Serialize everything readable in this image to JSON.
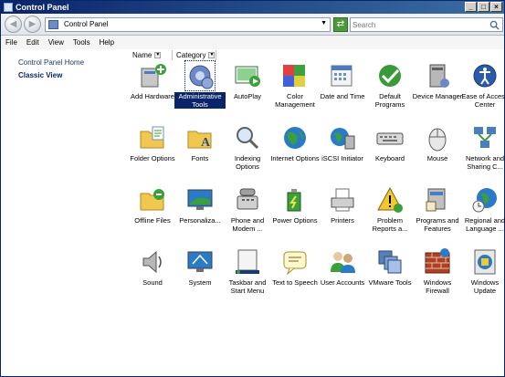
{
  "window": {
    "title": "Control Panel"
  },
  "title_buttons": [
    "_",
    "□",
    "×"
  ],
  "address": {
    "text": "Control Panel"
  },
  "search": {
    "placeholder": "Search"
  },
  "menu": [
    "File",
    "Edit",
    "View",
    "Tools",
    "Help"
  ],
  "left_pane": {
    "home": "Control Panel Home",
    "classic": "Classic View"
  },
  "columns": [
    "Name",
    "Category"
  ],
  "items": [
    {
      "label": "Add Hardware",
      "icon": "add-hardware-icon"
    },
    {
      "label": "Administrative Tools",
      "icon": "administrative-tools-icon",
      "selected": true
    },
    {
      "label": "AutoPlay",
      "icon": "autoplay-icon"
    },
    {
      "label": "Color Management",
      "icon": "color-management-icon"
    },
    {
      "label": "Date and Time",
      "icon": "date-time-icon"
    },
    {
      "label": "Default Programs",
      "icon": "default-programs-icon"
    },
    {
      "label": "Device Manager",
      "icon": "device-manager-icon"
    },
    {
      "label": "Ease of Access Center",
      "icon": "ease-of-access-icon"
    },
    {
      "label": "Folder Options",
      "icon": "folder-options-icon"
    },
    {
      "label": "Fonts",
      "icon": "fonts-icon"
    },
    {
      "label": "Indexing Options",
      "icon": "indexing-options-icon"
    },
    {
      "label": "Internet Options",
      "icon": "internet-options-icon"
    },
    {
      "label": "iSCSI Initiator",
      "icon": "iscsi-initiator-icon"
    },
    {
      "label": "Keyboard",
      "icon": "keyboard-icon"
    },
    {
      "label": "Mouse",
      "icon": "mouse-icon"
    },
    {
      "label": "Network and Sharing C...",
      "icon": "network-sharing-icon"
    },
    {
      "label": "Offline Files",
      "icon": "offline-files-icon"
    },
    {
      "label": "Personaliza...",
      "icon": "personalization-icon"
    },
    {
      "label": "Phone and Modem ...",
      "icon": "phone-modem-icon"
    },
    {
      "label": "Power Options",
      "icon": "power-options-icon"
    },
    {
      "label": "Printers",
      "icon": "printers-icon"
    },
    {
      "label": "Problem Reports a...",
      "icon": "problem-reports-icon"
    },
    {
      "label": "Programs and Features",
      "icon": "programs-features-icon"
    },
    {
      "label": "Regional and Language ...",
      "icon": "regional-language-icon"
    },
    {
      "label": "Sound",
      "icon": "sound-icon"
    },
    {
      "label": "System",
      "icon": "system-icon"
    },
    {
      "label": "Taskbar and Start Menu",
      "icon": "taskbar-start-menu-icon"
    },
    {
      "label": "Text to Speech",
      "icon": "text-to-speech-icon"
    },
    {
      "label": "User Accounts",
      "icon": "user-accounts-icon"
    },
    {
      "label": "VMware Tools",
      "icon": "vmware-tools-icon"
    },
    {
      "label": "Windows Firewall",
      "icon": "windows-firewall-icon"
    },
    {
      "label": "Windows Update",
      "icon": "windows-update-icon"
    }
  ]
}
